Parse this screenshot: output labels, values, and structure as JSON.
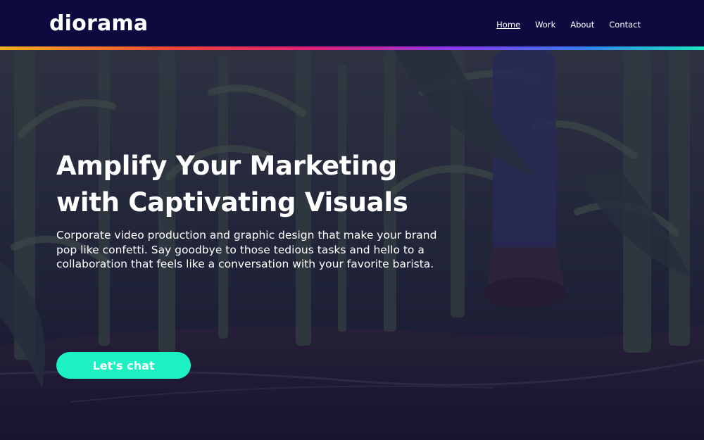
{
  "header": {
    "logo_text": "diorama",
    "nav": [
      {
        "label": "Home",
        "active": true
      },
      {
        "label": "Work",
        "active": false
      },
      {
        "label": "About",
        "active": false
      },
      {
        "label": "Contact",
        "active": false
      }
    ]
  },
  "hero": {
    "headline_line1": "Amplify Your Marketing",
    "headline_line2": "with Captivating Visuals",
    "subtext": "Corporate video production and graphic design that make your brand pop like confetti. Say goodbye to those tedious tasks and hello to a collaboration that feels like a conversation with your favorite barista.",
    "cta_label": "Let's chat"
  },
  "colors": {
    "header_bg": "#0c0a3e",
    "cta_bg": "#1df0c2",
    "overlay": "#161046",
    "accent_gradient": [
      "#f5b21a",
      "#f0423c",
      "#e0207a",
      "#8a3cf0",
      "#3a7bf0",
      "#19e6c0"
    ]
  }
}
